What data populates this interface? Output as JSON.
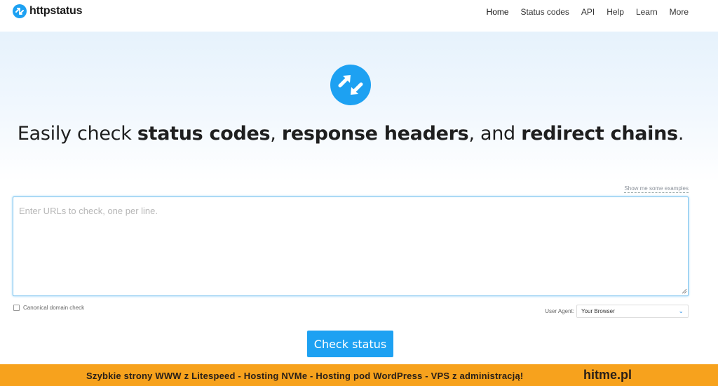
{
  "header": {
    "brand": "httpstatus",
    "nav": [
      "Home",
      "Status codes",
      "API",
      "Help",
      "Learn",
      "More"
    ]
  },
  "hero": {
    "headline_prefix": "Easily check ",
    "headline_b1": "status codes",
    "headline_sep1": ", ",
    "headline_b2": "response headers",
    "headline_sep2": ", and ",
    "headline_b3": "redirect chains",
    "headline_end": "."
  },
  "form": {
    "examples_link": "Show me some examples",
    "url_placeholder": "Enter URLs to check, one per line.",
    "canonical_label": "Canonical domain check",
    "user_agent_label": "User Agent:",
    "user_agent_value": "Your Browser",
    "submit_label": "Check status"
  },
  "banner": {
    "text": "Szybkie strony WWW z Litespeed - Hosting  NVMe - Hosting pod WordPress - VPS z administracją!",
    "brand": "hitme.pl"
  },
  "colors": {
    "accent": "#1da1f2",
    "banner": "#f7a21d"
  }
}
